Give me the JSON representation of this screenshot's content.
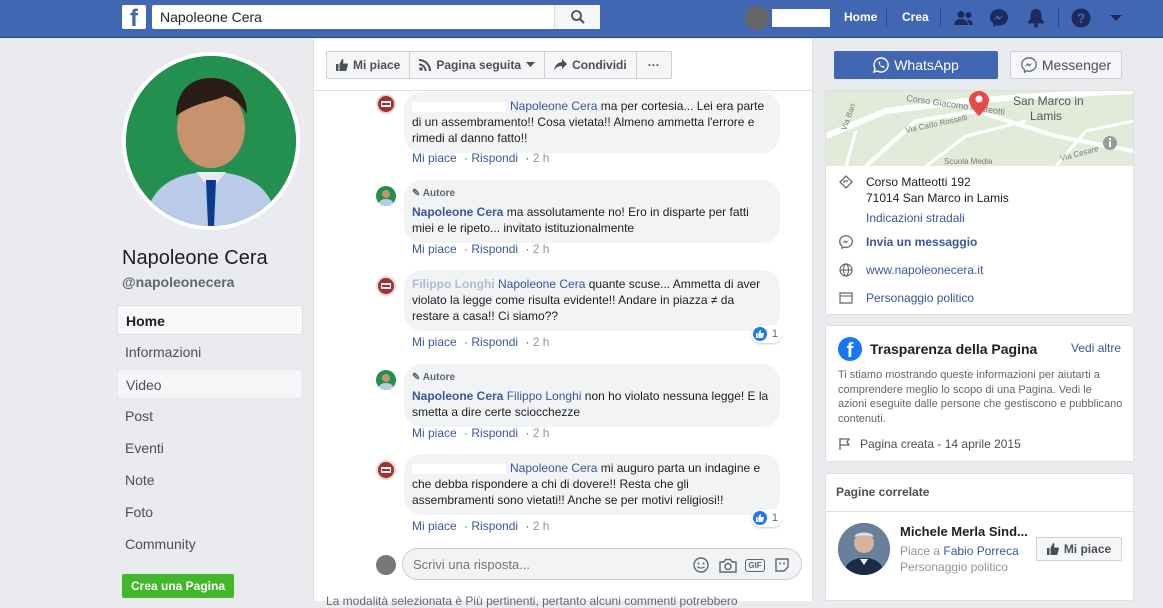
{
  "topbar": {
    "search_value": "Napoleone Cera",
    "home_label": "Home",
    "create_label": "Crea"
  },
  "page": {
    "name": "Napoleone Cera",
    "handle": "@napoleonecera"
  },
  "nav": {
    "items": [
      "Home",
      "Informazioni",
      "Video",
      "Post",
      "Eventi",
      "Note",
      "Foto",
      "Community"
    ],
    "create_page": "Crea una Pagina"
  },
  "actions": {
    "like": "Mi piace",
    "followed": "Pagina seguita",
    "share": "Condividi",
    "more": "···",
    "whatsapp": "WhatsApp",
    "messenger": "Messenger"
  },
  "comments": [
    {
      "author_label": "",
      "name": "",
      "mention": "Napoleone Cera",
      "text": "ma per cortesia... Lei era parte di un assembramento!! Cosa vietata!! Almeno ammetta l'errore e rimedi al danno fatto!!",
      "like": "Mi piace",
      "reply": "Rispondi",
      "time": "2 h",
      "reactions": ""
    },
    {
      "author_label": "Autore",
      "name": "Napoleone Cera",
      "mention": "",
      "text": "ma assolutamente no! Ero in disparte per fatti miei e le ripeto... invitato istituzionalmente",
      "like": "Mi piace",
      "reply": "Rispondi",
      "time": "2 h",
      "reactions": ""
    },
    {
      "author_label": "",
      "name": "Filippo Longhi",
      "mention": "Napoleone Cera",
      "text": "quante scuse... Ammetta di aver violato la legge come risulta evidente!! Andare in piazza ≠ da restare a casa!! Ci siamo??",
      "like": "Mi piace",
      "reply": "Rispondi",
      "time": "2 h",
      "reactions": "1"
    },
    {
      "author_label": "Autore",
      "name": "Napoleone Cera",
      "mention": "Filippo Longhi",
      "text": "non ho violato nessuna legge! E la smetta a dire certe sciocchezze",
      "like": "Mi piace",
      "reply": "Rispondi",
      "time": "2 h",
      "reactions": ""
    },
    {
      "author_label": "",
      "name": "",
      "mention": "Napoleone Cera",
      "text": "mi auguro parta un indagine e che debba rispondere a chi di dovere!! Resta che gli assembramenti sono vietati!! Anche se per motivi religiosi!!",
      "like": "Mi piace",
      "reply": "Rispondi",
      "time": "2 h",
      "reactions": "1"
    }
  ],
  "reply_box": {
    "placeholder": "Scrivi una risposta...",
    "gif": "GIF"
  },
  "footnote": "La modalità selezionata è Più pertinenti, pertanto alcuni commenti potrebbero",
  "map": {
    "label_town": "San Marco in Lamis",
    "street1": "Corso Giacomo Matteotti",
    "street2": "Via Carlo Rosselli",
    "street3": "Via Bari",
    "street4": "Via Cesare",
    "poi": "Scuola Media"
  },
  "info": {
    "address_line1": "Corso Matteotti 192",
    "address_line2": "71014 San Marco in Lamis",
    "directions": "Indicazioni stradali",
    "message": "Invia un messaggio",
    "website": "www.napoleonecera.it",
    "category": "Personaggio politico"
  },
  "transparency": {
    "title": "Trasparenza della Pagina",
    "see_all": "Vedi altre",
    "text": "Ti stiamo mostrando queste informazioni per aiutarti a comprendere meglio lo scopo di una Pagina. Vedi le azioni eseguite dalle persone che gestiscono e pubblicano contenuti.",
    "created": "Pagina creata - 14 aprile 2015"
  },
  "related": {
    "title": "Pagine correlate",
    "name": "Michele Merla Sind...",
    "likes_prefix": "Piace a",
    "likes_name": "Fabio Porreca",
    "category": "Personaggio politico",
    "like_button": "Mi piace"
  },
  "colors": {
    "brand": "#4267b2",
    "link": "#385898",
    "create_green": "#42b72a",
    "map_pin": "#e84a4a"
  }
}
